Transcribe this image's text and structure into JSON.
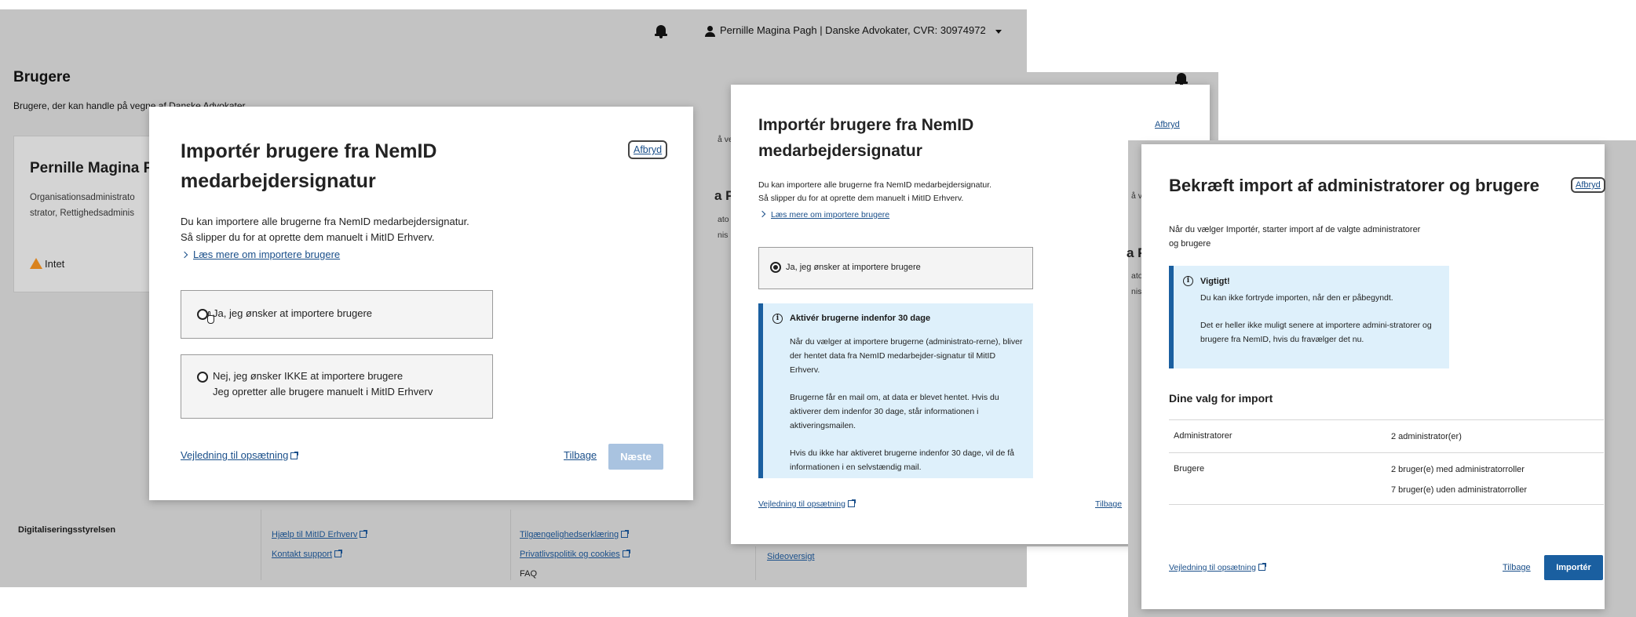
{
  "screen1": {
    "account": "Pernille Magina Pagh | Danske Advokater, CVR: 30974972",
    "page_title": "Brugere",
    "page_subtitle": "Brugere, der kan handle på vegne af Danske Advokater",
    "card": {
      "name": "Pernille Magina P",
      "roles_line1": "Organisationsadministrato",
      "roles_line2": "strator, Rettighedsadminis",
      "warning": "Intet"
    },
    "footer": {
      "org": "Digitaliseringsstyrelsen",
      "col1": [
        "Hjælp til MitID Erhverv",
        "Kontakt support"
      ],
      "col2": [
        "Tilgængelighedserklæring",
        "Privatlivspolitik og cookies",
        "FAQ"
      ],
      "col3": [
        "Sideoversigt"
      ]
    },
    "modal": {
      "title": "Importér brugere fra NemID medarbejdersignatur",
      "cancel": "Afbryd",
      "desc_line1": "Du kan importere alle brugerne fra NemID medarbejdersignatur.",
      "desc_line2": "Så slipper du for at oprette dem manuelt i MitID Erhverv.",
      "read_more": "Læs mere om importere brugere",
      "option_yes": "Ja, jeg ønsker at importere brugere",
      "option_no_line1": "Nej, jeg ønsker IKKE at importere brugere",
      "option_no_line2": "Jeg opretter alle brugere manuelt i MitID Erhverv",
      "guide": "Vejledning til opsætning",
      "back": "Tilbage",
      "next": "Næste"
    }
  },
  "screen2": {
    "peek_text": "å ve",
    "peek_name": "a P",
    "peek_roles1": "ato",
    "peek_roles2": "nis",
    "footer_col3": "Sideoversigt",
    "modal": {
      "title": "Importér brugere fra NemID medarbejdersignatur",
      "cancel": "Afbryd",
      "desc_line1": "Du kan importere alle brugerne fra NemID medarbejdersignatur.",
      "desc_line2": "Så slipper du for at oprette dem manuelt i MitID Erhverv.",
      "read_more": "Læs mere om importere brugere",
      "option_yes": "Ja, jeg ønsker at importere brugere",
      "info_heading": "Aktivér brugerne indenfor 30 dage",
      "info_p1": "Når du vælger at importere brugerne (administrato-rerne), bliver der hentet data fra NemID medarbejder-signatur til MitID Erhverv.",
      "info_p2": "Brugerne får en mail om, at data er blevet hentet. Hvis du aktiverer dem indenfor 30 dage, står informationen i aktiveringsmailen.",
      "info_p3": "Hvis du ikke har aktiveret brugerne indenfor 30 dage, vil de få informationen i en selvstændig mail.",
      "guide": "Vejledning til opsætning",
      "back": "Tilbage"
    }
  },
  "screen3": {
    "peek_text": "å ve",
    "peek_name": "a P",
    "peek_roles1": "ato",
    "peek_roles2": "nis",
    "modal": {
      "title": "Bekræft import af administratorer og brugere",
      "cancel": "Afbryd",
      "desc_line1": "Når du vælger Importér, starter import af de valgte administratorer",
      "desc_line2": "og brugere",
      "info_heading": "Vigtigt!",
      "info_p1": "Du kan ikke fortryde importen, når den er påbegyndt.",
      "info_p2": "Det er heller ikke muligt senere at importere admini-stratorer og brugere fra NemID, hvis du fravælger det nu.",
      "section_title": "Dine valg for import",
      "rows": [
        {
          "key": "Administratorer",
          "values": [
            "2 administrator(er)"
          ]
        },
        {
          "key": "Brugere",
          "values": [
            "2 bruger(e) med administratorroller",
            "7 bruger(e) uden administratorroller"
          ]
        }
      ],
      "guide": "Vejledning til opsætning",
      "back": "Tilbage",
      "import": "Importér"
    }
  }
}
